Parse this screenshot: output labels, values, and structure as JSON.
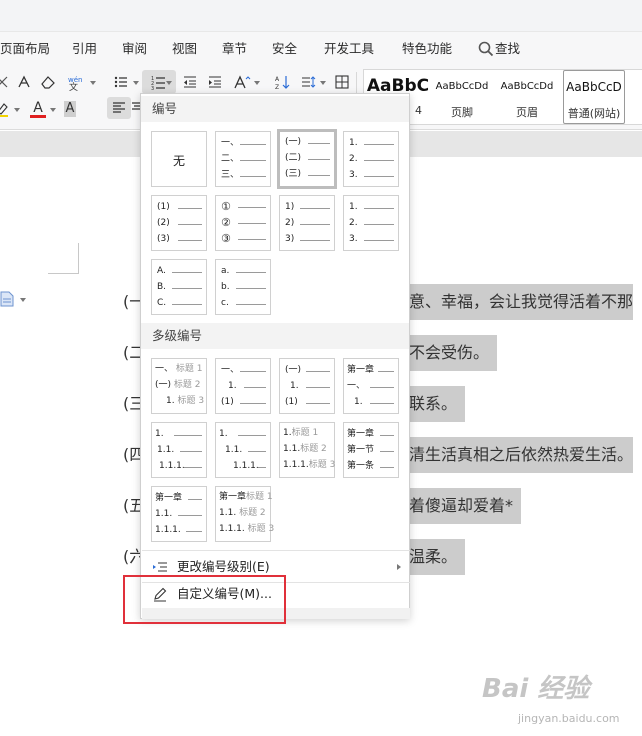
{
  "menu": {
    "items": [
      "页面布局",
      "引用",
      "审阅",
      "视图",
      "章节",
      "安全",
      "开发工具",
      "特色功能"
    ],
    "search_label": "查找"
  },
  "toolbar": {
    "font_color_label": "A",
    "highlight_label": "A",
    "grow_font_label": "A"
  },
  "styles": [
    {
      "sample": "AaBbC",
      "name": "4"
    },
    {
      "sample": "AaBbCcDd",
      "name": "页脚"
    },
    {
      "sample": "AaBbCcDd",
      "name": "页眉"
    },
    {
      "sample": "AaBbCcD",
      "name": "普通(网站)"
    }
  ],
  "document": {
    "lines": [
      {
        "num": "(一",
        "text": "意、幸福，会让我觉得活着不那"
      },
      {
        "num": "(二",
        "text": "不会受伤。"
      },
      {
        "num": "(三",
        "text": "联系。"
      },
      {
        "num": "(四",
        "text": "清生活真相之后依然热爱生活。"
      },
      {
        "num": "(五",
        "text": "着傻逼却爱着*"
      },
      {
        "num": "(六",
        "text": "温柔。"
      }
    ]
  },
  "dropdown": {
    "numbering_header": "编号",
    "multilevel_header": "多级编号",
    "none_label": "无",
    "tiles": {
      "chinese_dun": [
        "一、",
        "二、",
        "三、"
      ],
      "paren_chinese": [
        "(一)",
        "(二)",
        "(三)"
      ],
      "decimal_dot": [
        "1.",
        "2.",
        "3."
      ],
      "paren_num": [
        "(1)",
        "(2)",
        "(3)"
      ],
      "circled": [
        "①",
        "②",
        "③"
      ],
      "num_paren": [
        "1)",
        "2)",
        "3)"
      ],
      "decimal_dot_2": [
        "1.",
        "2.",
        "3."
      ],
      "upper_alpha": [
        "A.",
        "B.",
        "C."
      ],
      "lower_alpha": [
        "a.",
        "b.",
        "c."
      ]
    },
    "multi_tiles": {
      "m1": [
        {
          "m": "一、",
          "t": "标题 1"
        },
        {
          "m": "(一)",
          "t": "标题 2"
        },
        {
          "m": "1.",
          "t": "标题 3"
        }
      ],
      "m2": [
        "一、",
        "1.",
        "(1)"
      ],
      "m3": [
        "(一)",
        "1.",
        "(1)"
      ],
      "m4": [
        "第一章",
        "一、",
        "1."
      ],
      "m5": [
        "1.",
        "1.1.",
        "1.1.1."
      ],
      "m6": [
        "1.",
        "1.1.",
        "1.1.1."
      ],
      "m7": [
        {
          "m": "1.",
          "t": "标题 1"
        },
        {
          "m": "1.1.",
          "t": "标题 2"
        },
        {
          "m": "1.1.1.",
          "t": "标题 3"
        }
      ],
      "m8": [
        "第一章",
        "第一节",
        "第一条"
      ],
      "m9": [
        "第一章",
        "1.1.",
        "1.1.1."
      ],
      "m10": [
        {
          "m": "第一章",
          "t": "标题 1"
        },
        {
          "m": "1.1.",
          "t": "标题 2"
        },
        {
          "m": "1.1.1.",
          "t": "标题 3"
        }
      ]
    },
    "change_level_label": "更改编号级别(E)",
    "custom_label": "自定义编号(M)..."
  },
  "watermark": {
    "logo": "Bai 经验",
    "sub": "jingyan.baidu.com"
  },
  "colors": {
    "highlight": "#cccccc",
    "annotation": "#e0303a",
    "accent_blue": "#2b6cd6"
  }
}
